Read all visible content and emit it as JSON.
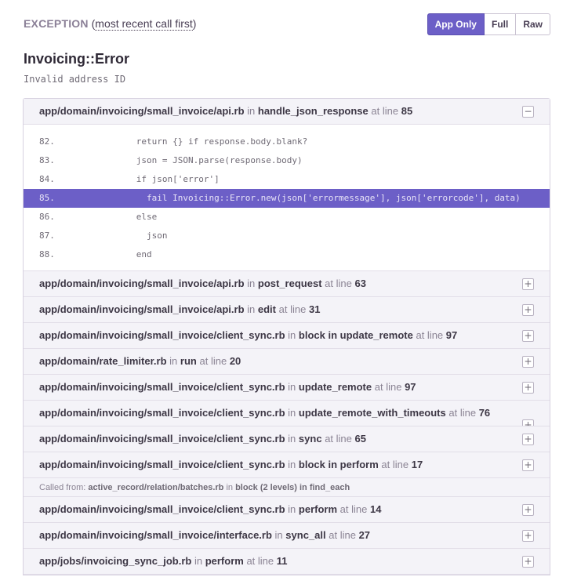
{
  "header": {
    "exception_label": "EXCEPTION",
    "open_paren": "(",
    "recent_label": "most recent call first",
    "close_paren": ")"
  },
  "view_toggle": {
    "app_only": "App Only",
    "full": "Full",
    "raw": "Raw",
    "selected": "App Only"
  },
  "exception": {
    "type": "Invoicing::Error",
    "message": "Invalid address ID"
  },
  "labels": {
    "in": "in",
    "at_line": "at line"
  },
  "frames": [
    {
      "file": "app/domain/invoicing/small_invoice/api.rb",
      "function": "handle_json_response",
      "line": "85",
      "expanded": true,
      "toggle": "−",
      "context": [
        {
          "num": "82.",
          "code": "      return {} if response.body.blank?"
        },
        {
          "num": "83.",
          "code": "      json = JSON.parse(response.body)"
        },
        {
          "num": "84.",
          "code": "      if json['error']"
        },
        {
          "num": "85.",
          "code": "        fail Invoicing::Error.new(json['errormessage'], json['errorcode'], data)",
          "active": true
        },
        {
          "num": "86.",
          "code": "      else"
        },
        {
          "num": "87.",
          "code": "        json"
        },
        {
          "num": "88.",
          "code": "      end"
        }
      ]
    },
    {
      "file": "app/domain/invoicing/small_invoice/api.rb",
      "function": "post_request",
      "line": "63",
      "toggle": "+"
    },
    {
      "file": "app/domain/invoicing/small_invoice/api.rb",
      "function": "edit",
      "line": "31",
      "toggle": "+"
    },
    {
      "file": "app/domain/invoicing/small_invoice/client_sync.rb",
      "function": "block in update_remote",
      "line": "97",
      "toggle": "+"
    },
    {
      "file": "app/domain/rate_limiter.rb",
      "function": "run",
      "line": "20",
      "toggle": "+"
    },
    {
      "file": "app/domain/invoicing/small_invoice/client_sync.rb",
      "function": "update_remote",
      "line": "97",
      "toggle": "+"
    },
    {
      "file": "app/domain/invoicing/small_invoice/client_sync.rb",
      "function": "update_remote_with_timeouts",
      "line": "76",
      "toggle": "+"
    },
    {
      "file": "app/domain/invoicing/small_invoice/client_sync.rb",
      "function": "sync",
      "line": "65",
      "toggle": "+"
    },
    {
      "file": "app/domain/invoicing/small_invoice/client_sync.rb",
      "function": "block in perform",
      "line": "17",
      "toggle": "+"
    },
    {
      "file": "app/domain/invoicing/small_invoice/client_sync.rb",
      "function": "perform",
      "line": "14",
      "toggle": "+"
    },
    {
      "file": "app/domain/invoicing/small_invoice/interface.rb",
      "function": "sync_all",
      "line": "27",
      "toggle": "+"
    },
    {
      "file": "app/jobs/invoicing_sync_job.rb",
      "function": "perform",
      "line": "11",
      "toggle": "+"
    }
  ],
  "called_from": {
    "label": "Called from:",
    "file": "active_record/relation/batches.rb",
    "in": "in",
    "function": "block (2 levels) in find_each"
  },
  "colors": {
    "accent": "#6c5fc7",
    "frame_bg": "#f4f3f8",
    "border": "#d7d1e0"
  }
}
